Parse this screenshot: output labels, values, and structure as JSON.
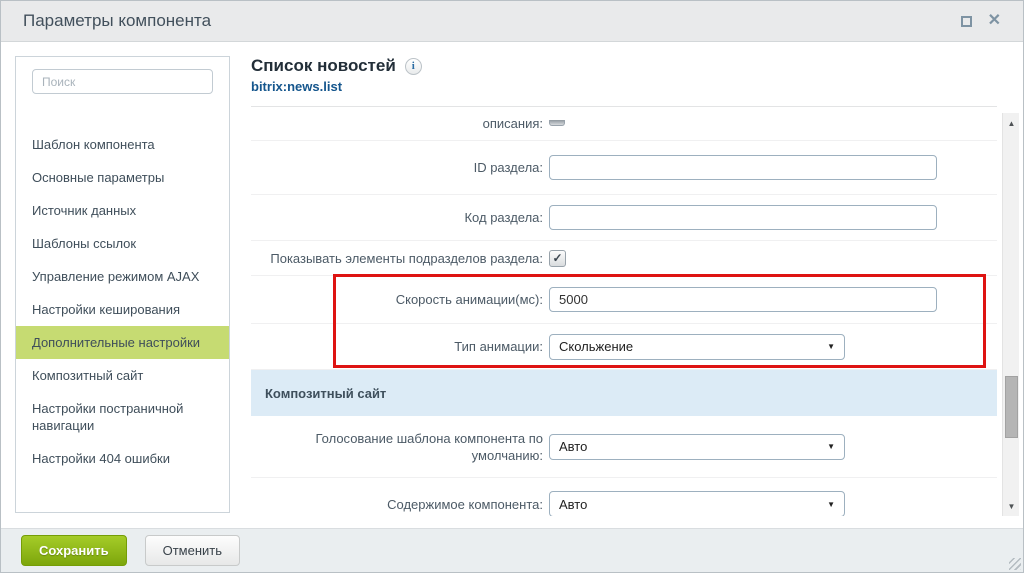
{
  "window": {
    "title": "Параметры компонента",
    "close_icon": "✕"
  },
  "sidebar": {
    "search_placeholder": "Поиск",
    "items": [
      {
        "label": "Шаблон компонента",
        "selected": false
      },
      {
        "label": "Основные параметры",
        "selected": false
      },
      {
        "label": "Источник данных",
        "selected": false
      },
      {
        "label": "Шаблоны ссылок",
        "selected": false
      },
      {
        "label": "Управление режимом AJAX",
        "selected": false
      },
      {
        "label": "Настройки кеширования",
        "selected": false
      },
      {
        "label": "Дополнительные настройки",
        "selected": true
      },
      {
        "label": "Композитный сайт",
        "selected": false
      },
      {
        "label": "Настройки постраничной навигации",
        "selected": false
      },
      {
        "label": "Настройки 404 ошибки",
        "selected": false
      }
    ]
  },
  "header": {
    "title": "Список новостей",
    "info_icon": "i",
    "component": "bitrix:news.list"
  },
  "form": {
    "rows": [
      {
        "type": "partial-checkbox",
        "label": "описания:"
      },
      {
        "type": "text",
        "label": "ID раздела:",
        "value": ""
      },
      {
        "type": "text",
        "label": "Код раздела:",
        "value": ""
      },
      {
        "type": "checkbox",
        "label": "Показывать элементы подразделов раздела:",
        "checked": true,
        "check_glyph": "✓"
      },
      {
        "type": "text",
        "label": "Скорость анимации(мс):",
        "value": "5000"
      },
      {
        "type": "select",
        "label": "Тип анимации:",
        "value": "Скольжение",
        "arrow": "▼"
      },
      {
        "type": "section",
        "label": "Композитный сайт"
      },
      {
        "type": "select",
        "label": "Голосование шаблона компонента по умолчанию:",
        "value": "Авто",
        "arrow": "▼"
      },
      {
        "type": "select",
        "label": "Содержимое компонента:",
        "value": "Авто",
        "arrow": "▼"
      }
    ]
  },
  "scrollbar": {
    "up_arrow": "▲",
    "down_arrow": "▼"
  },
  "footer": {
    "save_label": "Сохранить",
    "cancel_label": "Отменить"
  },
  "colors": {
    "accent_green_button": "#8bb015",
    "sidebar_selected_green": "#c6db72",
    "highlight_red": "#de1312",
    "link_blue": "#15568d",
    "section_band_blue": "#dcebf6",
    "titlebar_gray": "#e9eaeb"
  }
}
